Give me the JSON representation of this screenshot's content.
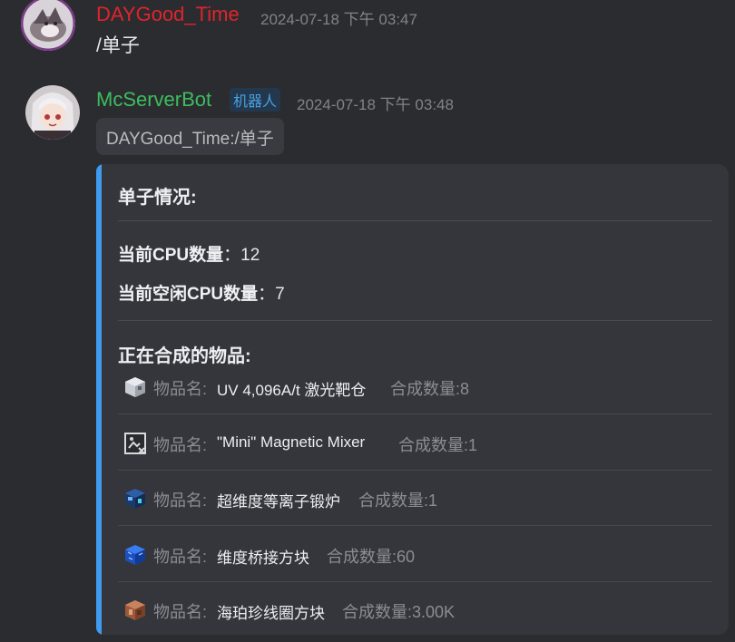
{
  "messages": [
    {
      "author": "DAYGood_Time",
      "author_color": "#e0242b",
      "timestamp": "2024-07-18 下午 03:47",
      "text": "/单子"
    },
    {
      "author": "McServerBot",
      "author_color": "#3dbd5e",
      "badge": "机器人",
      "timestamp": "2024-07-18 下午 03:48",
      "quote": "DAYGood_Time:/单子",
      "card": {
        "title": "单子情况:",
        "cpu_total_label": "当前CPU数量",
        "cpu_total_value": "：12",
        "cpu_idle_label": "当前空闲CPU数量",
        "cpu_idle_value": "：7",
        "crafting_title": "正在合成的物品:",
        "items": [
          {
            "icon": "laser-target-hatch-icon",
            "label": "物品名:",
            "name": "UV 4,096A/t 激光靶仓",
            "count": "合成数量:8"
          },
          {
            "icon": "missing-texture-icon",
            "label": "物品名:",
            "name": "\"Mini\" Magnetic Mixer",
            "count": "合成数量:1"
          },
          {
            "icon": "dimensional-plasma-forge-icon",
            "label": "物品名:",
            "name": "超维度等离子锻炉",
            "count": "合成数量:1"
          },
          {
            "icon": "dimensional-bridge-block-icon",
            "label": "物品名:",
            "name": "维度桥接方块",
            "count": "合成数量:60"
          },
          {
            "icon": "amber-coil-block-icon",
            "label": "物品名:",
            "name": "海珀珍线圈方块",
            "count": "合成数量:3.00K"
          }
        ]
      }
    }
  ],
  "colors": {
    "background": "#2b2c30",
    "card": "#35363c",
    "accent_bar": "#3f9bf0",
    "muted_text": "#8a8d94"
  }
}
